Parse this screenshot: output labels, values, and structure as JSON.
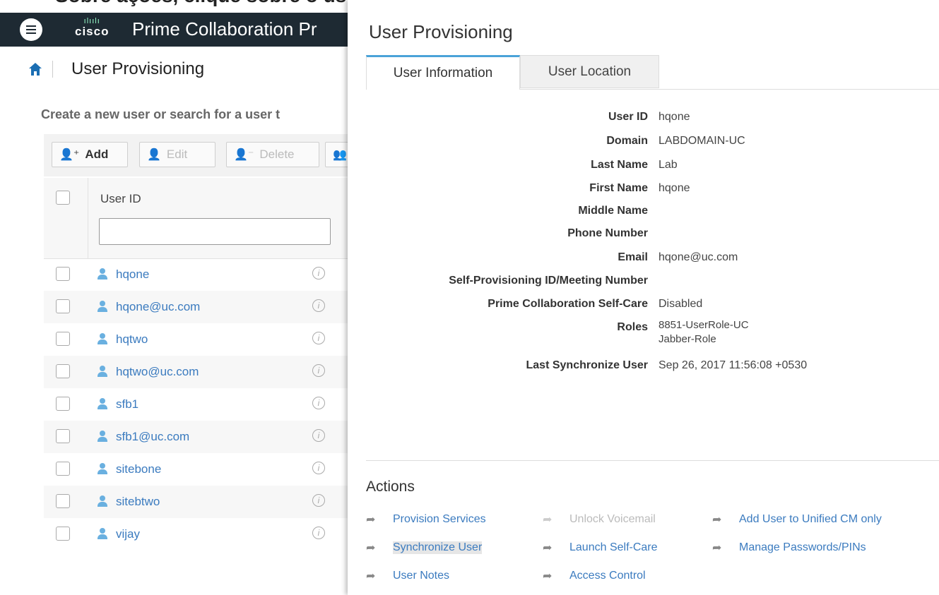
{
  "top_caption": "Sobre ações, clique sobre o usuário ao sincronizar",
  "app": {
    "logo_text": "cisco",
    "title": "Prime Collaboration Pr"
  },
  "breadcrumb": {
    "title": "User Provisioning"
  },
  "left": {
    "create_text": "Create a new user or search for a user t",
    "toolbar": {
      "add": "Add",
      "edit": "Edit",
      "delete": "Delete"
    },
    "column_header": "User ID",
    "filter_value": "",
    "users": [
      "hqone",
      "hqone@uc.com",
      "hqtwo",
      "hqtwo@uc.com",
      "sfb1",
      "sfb1@uc.com",
      "sitebone",
      "sitebtwo",
      "vijay"
    ]
  },
  "panel": {
    "title": "User Provisioning",
    "tabs": [
      "User Information",
      "User Location"
    ],
    "fields": [
      {
        "label": "User ID",
        "value": "hqone"
      },
      {
        "label": "Domain",
        "value": "LABDOMAIN-UC"
      },
      {
        "label": "Last Name",
        "value": "Lab"
      },
      {
        "label": "First Name",
        "value": "hqone"
      },
      {
        "label": "Middle Name",
        "value": ""
      },
      {
        "label": "Phone Number",
        "value": ""
      },
      {
        "label": "Email",
        "value": "hqone@uc.com"
      },
      {
        "label": "Self-Provisioning ID/Meeting Number",
        "value": ""
      },
      {
        "label": "Prime Collaboration Self-Care",
        "value": "Disabled"
      },
      {
        "label": "Roles",
        "value": "8851-UserRole-UC",
        "value2": "Jabber-Role"
      },
      {
        "label": "Last Synchronize User",
        "value": "Sep 26, 2017 11:56:08 +0530"
      }
    ],
    "actions_title": "Actions",
    "actions": {
      "provision_services": "Provision Services",
      "synchronize_user": "Synchronize User",
      "user_notes": "User Notes",
      "unlock_voicemail": "Unlock Voicemail",
      "launch_self_care": "Launch Self-Care",
      "access_control": "Access Control",
      "add_user_unified": "Add User to Unified CM only",
      "manage_passwords": "Manage Passwords/PINs"
    }
  },
  "colors": {
    "accent": "#4aa3d8",
    "link": "#3b7bbf",
    "topbar": "#1e2a33"
  }
}
